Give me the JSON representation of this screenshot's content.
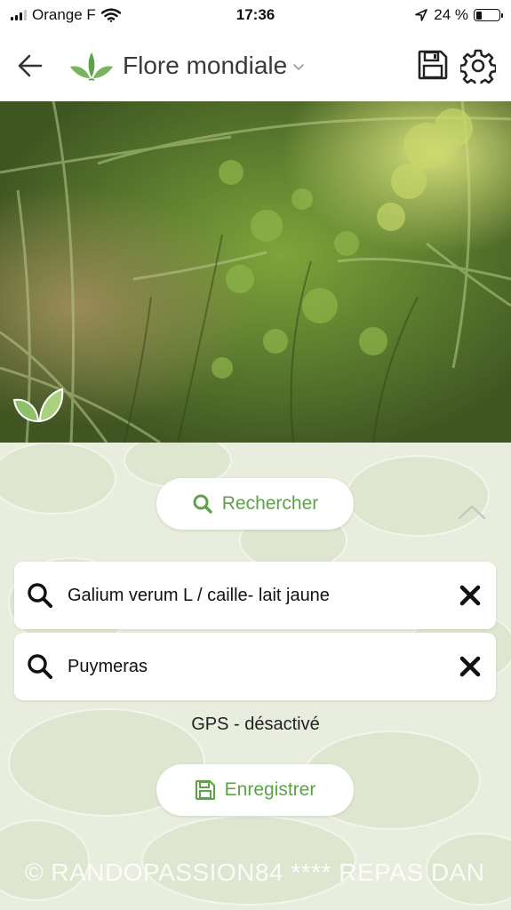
{
  "status_bar": {
    "carrier": "Orange F",
    "time": "17:36",
    "battery_text": "24 %",
    "battery_level": 0.24
  },
  "header": {
    "title": "Flore mondiale",
    "icons": [
      "back-arrow-icon",
      "leaves-logo-icon",
      "chevron-down-icon",
      "floppy-save-icon",
      "gear-icon"
    ]
  },
  "search_button": {
    "label": "Rechercher",
    "icon": "search-icon"
  },
  "fields": [
    {
      "value": "Galium verum L / caille- lait jaune"
    },
    {
      "value": "Puymeras"
    }
  ],
  "gps_status": "GPS - désactivé",
  "record_button": {
    "label": "Enregistrer",
    "icon": "floppy-save-icon"
  },
  "watermark": "© RANDOPASSION84 ****   REPAS DAN",
  "colors": {
    "accent": "#5fa14a",
    "panel_bg": "#e9eede"
  }
}
